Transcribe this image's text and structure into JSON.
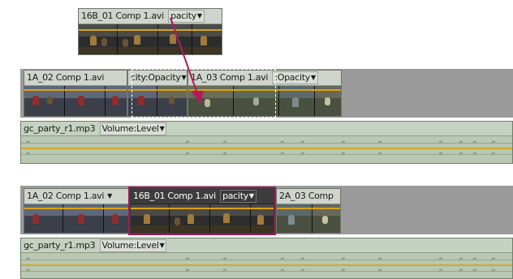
{
  "drag_clip": {
    "name": "16B_01 Comp 1.avi",
    "effect": "pacity"
  },
  "panel_before": {
    "video_clips": [
      {
        "name": "1A_02 Comp 1.avi",
        "effect_partial": "city:Opacity"
      },
      {
        "name": "1A_03 Comp 1.avi",
        "effect": ":Opacity"
      }
    ],
    "audio_clip": {
      "name": "gc_party_r1.mp3",
      "effect": "Volume:Level"
    }
  },
  "panel_after": {
    "video_clips": [
      {
        "name": "1A_02 Comp 1.avi"
      },
      {
        "name": "16B_01 Comp 1.avi",
        "effect": "pacity"
      },
      {
        "name": "2A_03 Comp"
      }
    ],
    "audio_clip": {
      "name": "gc_party_r1.mp3",
      "effect": "Volume:Level"
    }
  },
  "colors": {
    "track_bg": "#9a9a9a",
    "video_clip": "#c8cec5",
    "audio_clip": "#b9c7b3",
    "highlight": "#a0195a",
    "arrow": "#b01a5c",
    "keyline": "#d9a21a"
  },
  "icons": {
    "dropdown": "chevron-down-icon",
    "arrow": "drag-arrow-icon"
  }
}
